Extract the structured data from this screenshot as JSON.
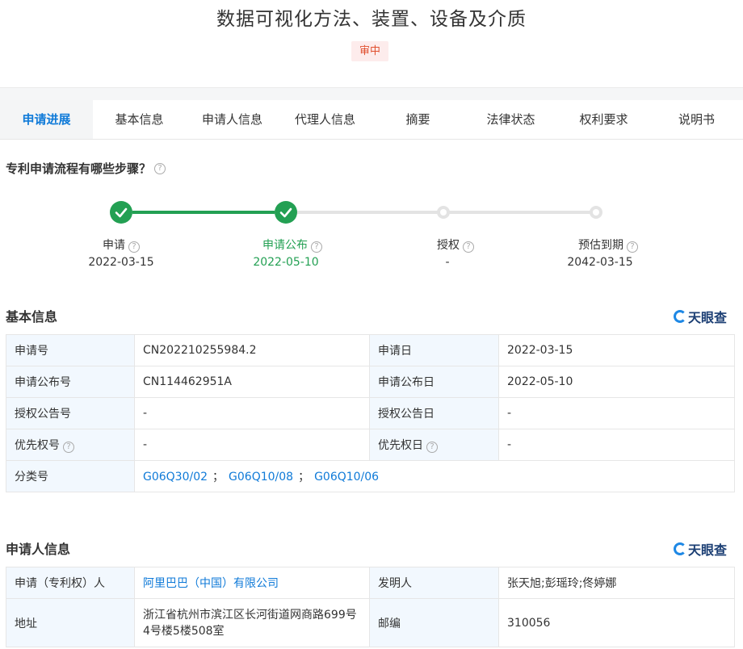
{
  "title": "数据可视化方法、装置、设备及介质",
  "status": "审中",
  "tabs": [
    "申请进展",
    "基本信息",
    "申请人信息",
    "代理人信息",
    "摘要",
    "法律状态",
    "权利要求",
    "说明书"
  ],
  "flow_question": "专利申请流程有哪些步骤？",
  "help_glyph": "?",
  "steps": [
    {
      "label": "申请",
      "date": "2022-03-15",
      "done": true
    },
    {
      "label": "申请公布",
      "date": "2022-05-10",
      "done": true
    },
    {
      "label": "授权",
      "date": "-",
      "done": false
    },
    {
      "label": "预估到期",
      "date": "2042-03-15",
      "done": false
    }
  ],
  "brand": "天眼查",
  "basic": {
    "title": "基本信息",
    "rows": [
      {
        "l1": "申请号",
        "v1": "CN202210255984.2",
        "l2": "申请日",
        "v2": "2022-03-15"
      },
      {
        "l1": "申请公布号",
        "v1": "CN114462951A",
        "l2": "申请公布日",
        "v2": "2022-05-10"
      },
      {
        "l1": "授权公告号",
        "v1": "-",
        "l2": "授权公告日",
        "v2": "-"
      },
      {
        "l1": "优先权号",
        "v1": "-",
        "l2": "优先权日",
        "v2": "-"
      }
    ],
    "class_label": "分类号",
    "classes": [
      "G06Q30/02",
      "G06Q10/08",
      "G06Q10/06"
    ],
    "class_sep": "；"
  },
  "applicant": {
    "title": "申请人信息",
    "applicant_label": "申请（专利权）人",
    "applicant_value": "阿里巴巴（中国）有限公司",
    "inventor_label": "发明人",
    "inventor_value": "张天旭;彭瑶玲;佟婷娜",
    "address_label": "地址",
    "address_value": "浙江省杭州市滨江区长河街道网商路699号4号楼5楼508室",
    "zip_label": "邮编",
    "zip_value": "310056"
  },
  "colors": {
    "accent": "#0f7ad8",
    "success": "#23a053",
    "status": "#e0502f"
  }
}
